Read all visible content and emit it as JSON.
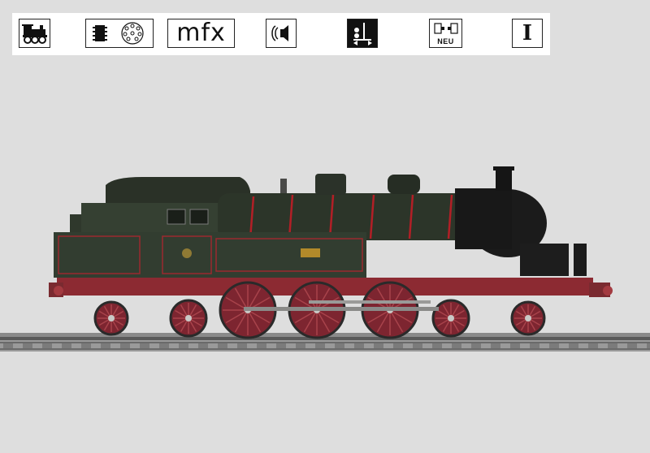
{
  "feature_icons": {
    "digital_decoder": "mfx",
    "new_item": "NEU",
    "gauge": "I"
  },
  "icon_names": [
    "steam-locomotive-icon",
    "decoder-chip-icon",
    "mfx-label",
    "sound-icon",
    "signal-switch-icon",
    "new-coupler-icon",
    "gauge-one-icon"
  ],
  "colors": {
    "background": "#dedede",
    "locomotive_body": "#2c3529",
    "locomotive_lining": "#c0222a",
    "frame_red": "#8c2a32",
    "boiler_front": "#151515"
  }
}
